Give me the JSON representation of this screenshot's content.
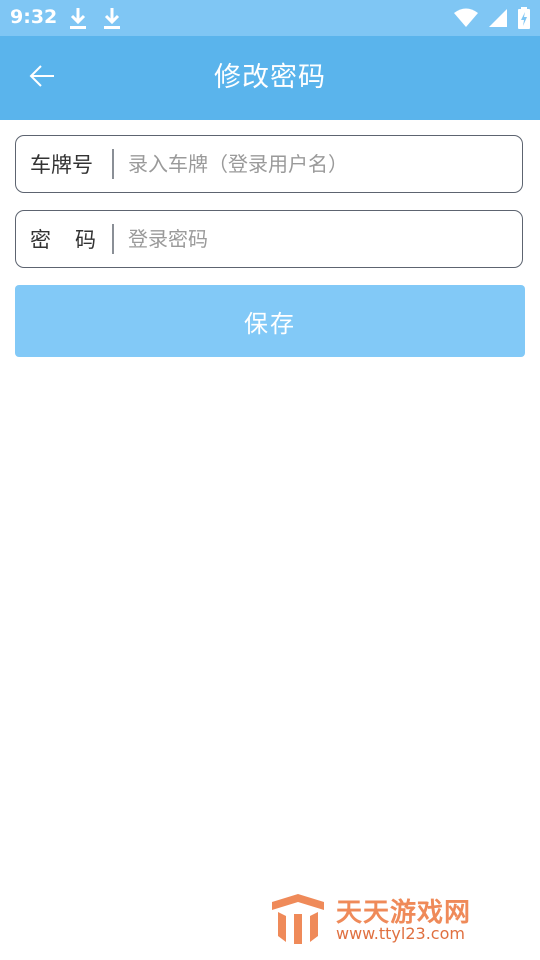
{
  "status_bar": {
    "time": "9:32",
    "icons": [
      "download-icon",
      "download-icon",
      "wifi-icon",
      "signal-icon",
      "battery-icon"
    ]
  },
  "header": {
    "title": "修改密码",
    "back_icon": "arrow-left-icon"
  },
  "form": {
    "plate": {
      "label": "车牌号",
      "placeholder": "录入车牌（登录用户名）",
      "value": ""
    },
    "password": {
      "label_chars": [
        "密",
        "码"
      ],
      "placeholder": "登录密码",
      "value": ""
    },
    "save_label": "保存"
  },
  "watermark": {
    "name": "天天游戏网",
    "url": "www.ttyl23.com"
  },
  "colors": {
    "status_bar": "#7fc6f4",
    "app_bar": "#5ab4ec",
    "save_button": "#82c9f7",
    "watermark": "#ef8a59"
  }
}
